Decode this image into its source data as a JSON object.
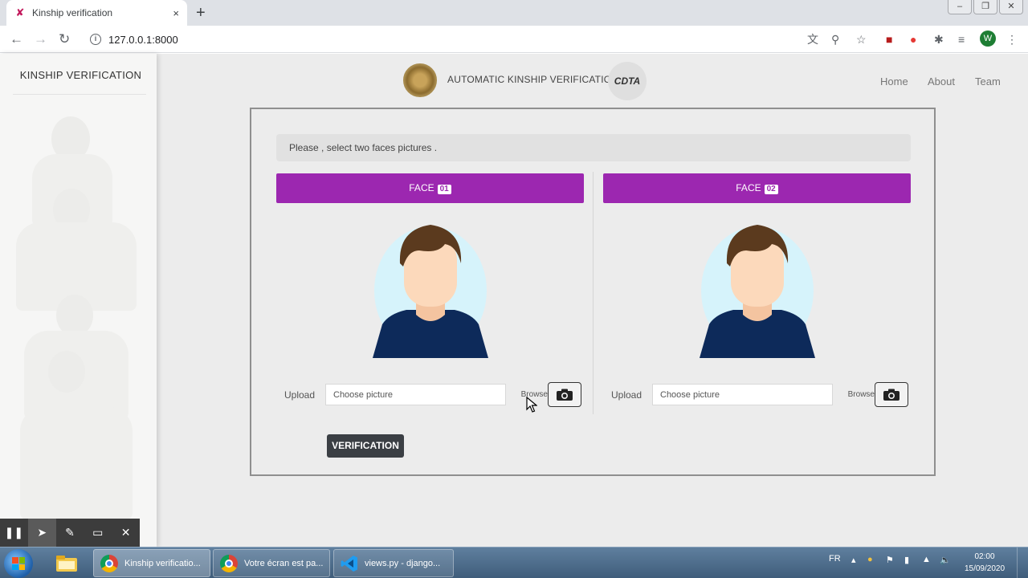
{
  "browser": {
    "tab_title": "Kinship verification",
    "tab_close": "×",
    "new_tab": "+",
    "url": "127.0.0.1:8000",
    "profile_initial": "W"
  },
  "sidebar": {
    "brand": "KINSHIP VERIFICATION"
  },
  "header": {
    "app_title": "AUTOMATIC KINSHIP VERIFICATION",
    "cdta_logo_text": "CDTA",
    "nav": [
      "Home",
      "About",
      "Team"
    ]
  },
  "main": {
    "notice": "Please , select two faces pictures .",
    "faces": [
      {
        "header_label": "FACE",
        "badge": "01",
        "upload_label": "Upload",
        "file_placeholder": "Choose picture",
        "browse_label": "Browse"
      },
      {
        "header_label": "FACE",
        "badge": "02",
        "upload_label": "Upload",
        "file_placeholder": "Choose picture",
        "browse_label": "Browse"
      }
    ],
    "verify_button": "VERIFICATION"
  },
  "taskbar": {
    "tasks": [
      {
        "label": "Kinship verificatio...",
        "icon": "chrome-icon"
      },
      {
        "label": "Votre écran est pa...",
        "icon": "chrome-icon"
      },
      {
        "label": "views.py - django...",
        "icon": "vscode-icon"
      }
    ],
    "language": "FR",
    "time": "02:00",
    "date": "15/09/2020"
  },
  "colors": {
    "face_header": "#9c27b0",
    "verify_button": "#3b3f44",
    "page_background": "#ececec",
    "avatar_hair": "#5b3a1e",
    "avatar_skin": "#fcd9bb",
    "avatar_shirt": "#0d2a5a",
    "avatar_halo": "#d6f3fb"
  }
}
